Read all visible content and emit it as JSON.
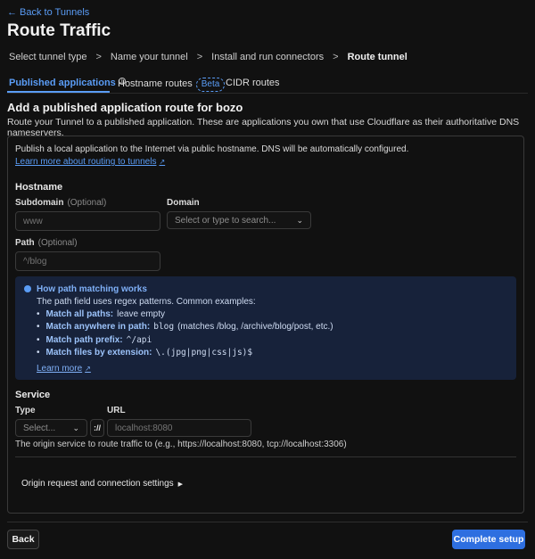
{
  "nav": {
    "back_label": "Back to Tunnels",
    "page_title": "Route Traffic"
  },
  "steps": [
    {
      "label": "Select tunnel type",
      "current": false
    },
    {
      "label": "Name your tunnel",
      "current": false
    },
    {
      "label": "Install and run connectors",
      "current": false
    },
    {
      "label": "Route tunnel",
      "current": true
    }
  ],
  "step_separator": ">",
  "tabs": [
    {
      "label": "Published applications",
      "active": true
    },
    {
      "label": "Hostname routes",
      "active": false,
      "badge": "Beta"
    },
    {
      "label": "CIDR routes",
      "active": false
    }
  ],
  "section": {
    "title": "Add a published application route for bozo",
    "description": "Route your Tunnel to a published application. These are applications you own that use Cloudflare as their authoritative DNS nameservers."
  },
  "card": {
    "description": "Publish a local application to the Internet via public hostname. DNS will be automatically configured.",
    "learn_more": "Learn more about routing to tunnels",
    "hostname_heading": "Hostname",
    "subdomain": {
      "label": "Subdomain",
      "optional": "(Optional)",
      "placeholder": "www",
      "value": ""
    },
    "domain": {
      "label": "Domain",
      "placeholder": "Select or type to search..."
    },
    "path": {
      "label": "Path",
      "optional": "(Optional)",
      "placeholder": "^/blog",
      "value": ""
    },
    "note": {
      "title": "How path matching works",
      "text": "The path field uses regex patterns. Common examples:",
      "items": [
        {
          "label": "Match all paths:",
          "code": "",
          "rest": "leave empty"
        },
        {
          "label": "Match anywhere in path:",
          "code": "blog",
          "rest": "(matches /blog, /archive/blog/post, etc.)"
        },
        {
          "label": "Match path prefix:",
          "code": "^/api",
          "rest": ""
        },
        {
          "label": "Match files by extension:",
          "code": "\\.(jpg|png|css|js)$",
          "rest": ""
        }
      ],
      "learn_more": "Learn more"
    },
    "service_heading": "Service",
    "type": {
      "label": "Type",
      "placeholder": "Select..."
    },
    "scheme_separator": "://",
    "url": {
      "label": "URL",
      "placeholder": "localhost:8080",
      "value": ""
    },
    "service_help": "The origin service to route traffic to (e.g., https://localhost:8080, tcp://localhost:3306)",
    "origin_settings": "Origin request and connection settings"
  },
  "footer": {
    "back": "Back",
    "complete": "Complete setup"
  },
  "colors": {
    "accent": "#5a9cf5",
    "primary_button": "#2e6fe0",
    "background": "#111111",
    "note_background": "#17223a"
  },
  "icons": {
    "back": "arrow-left-icon",
    "external": "external-link-icon",
    "info": "info-icon",
    "chevron": "chevron-down-icon",
    "caret": "caret-right-icon"
  }
}
